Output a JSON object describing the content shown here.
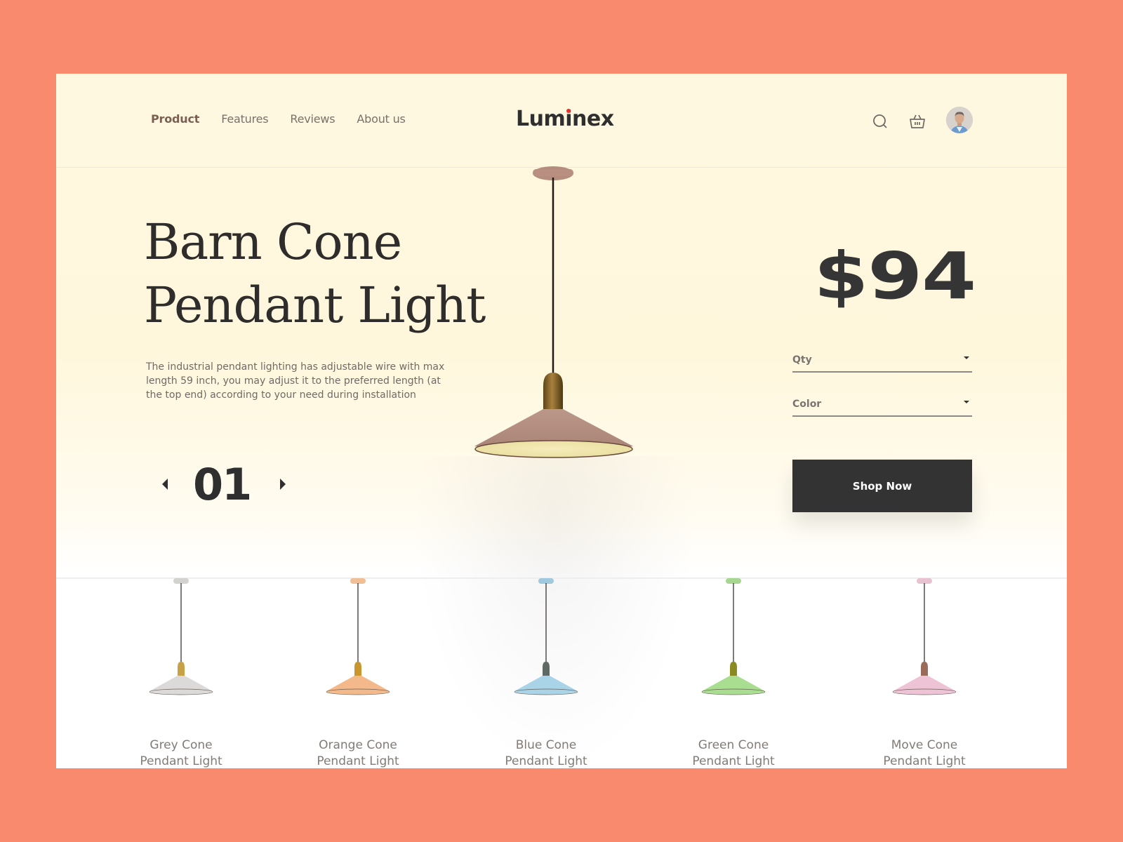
{
  "brand": {
    "name_pre": "Lum",
    "name_i": "i",
    "name_post": "nex",
    "accent_dot_color": "#ee2c2c"
  },
  "nav": {
    "items": [
      {
        "label": "Product",
        "active": true
      },
      {
        "label": "Features",
        "active": false
      },
      {
        "label": "Reviews",
        "active": false
      },
      {
        "label": "About us",
        "active": false
      }
    ]
  },
  "header_icons": {
    "search": "search-icon",
    "cart": "basket-icon",
    "profile": "user-avatar"
  },
  "hero": {
    "title_line1": "Barn Cone",
    "title_line2": "Pendant Light",
    "description": "The industrial pendant lighting has adjustable wire with max length 59 inch, you may adjust it to the preferred length (at the top end) according to your need during installation",
    "slide_number": "01",
    "shade_color": "#c9a08e"
  },
  "purchase": {
    "price": "$94",
    "qty_label": "Qty",
    "color_label": "Color",
    "shop_button": "Shop Now"
  },
  "variants": [
    {
      "name_line1": "Grey Cone",
      "name_line2": "Pendant Light",
      "color": "#dcdad8",
      "canopy": "#d4d2cf",
      "socket": "#c8a146"
    },
    {
      "name_line1": "Orange Cone",
      "name_line2": "Pendant Light",
      "color": "#f3b98a",
      "canopy": "#f0bf95",
      "socket": "#c8952e"
    },
    {
      "name_line1": "Blue Cone",
      "name_line2": "Pendant Light",
      "color": "#a9d3e6",
      "canopy": "#9fc9dc",
      "socket": "#5f6a64"
    },
    {
      "name_line1": "Green Cone",
      "name_line2": "Pendant Light",
      "color": "#a9dd8f",
      "canopy": "#a7d691",
      "socket": "#8b8a20"
    },
    {
      "name_line1": "Move Cone",
      "name_line2": "Pendant Light",
      "color": "#eec3d5",
      "canopy": "#e8c2d0",
      "socket": "#9a6b58"
    }
  ]
}
